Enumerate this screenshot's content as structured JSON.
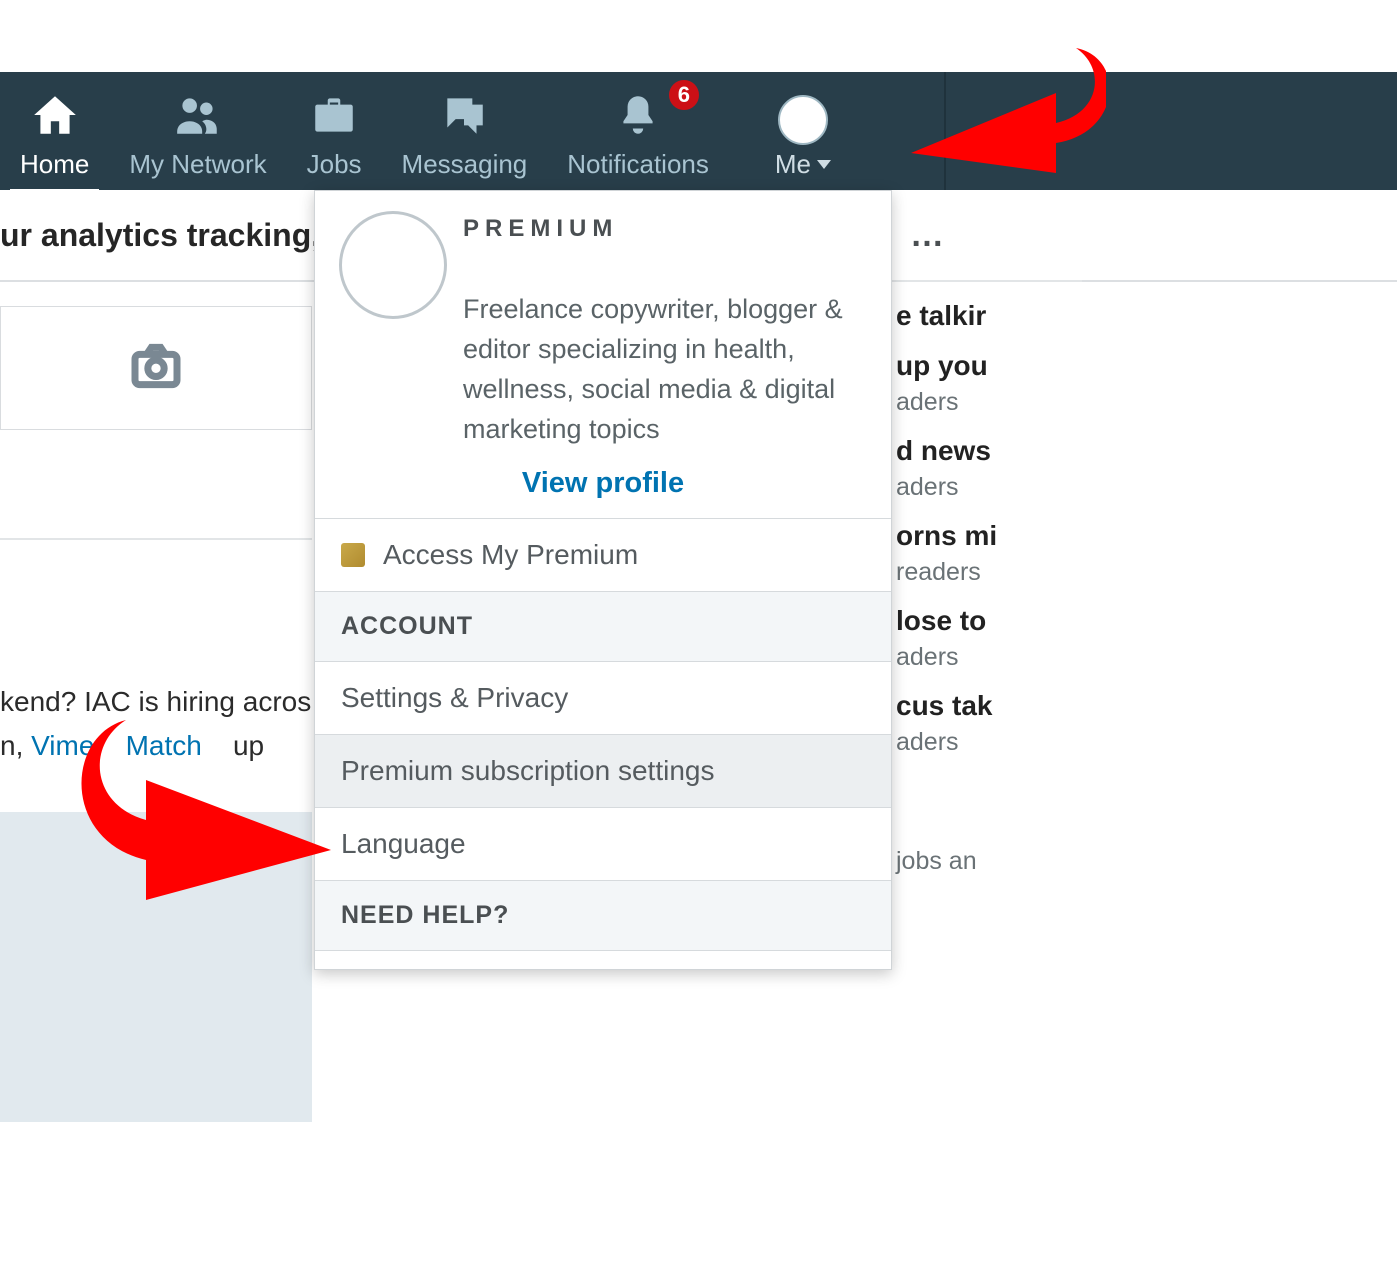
{
  "nav": {
    "items": [
      {
        "label": "Home",
        "active": true
      },
      {
        "label": "My Network"
      },
      {
        "label": "Jobs"
      },
      {
        "label": "Messaging"
      },
      {
        "label": "Notifications",
        "badge": "6"
      }
    ],
    "me_label": "Me"
  },
  "banner": {
    "text": "ur analytics tracking,"
  },
  "dropdown": {
    "premium_label": "PREMIUM",
    "headline": "Freelance copywriter, blogger & editor specializing in health, wellness, social media & digital marketing topics",
    "view_profile": "View profile",
    "access_premium": "Access My Premium",
    "account_header": "ACCOUNT",
    "settings_privacy": "Settings & Privacy",
    "premium_sub": "Premium subscription settings",
    "language": "Language",
    "need_help_header": "NEED HELP?"
  },
  "feed": {
    "line1": "kend? IAC is hiring acros",
    "line2_prefix": "n, ",
    "line2_link1": "Vime",
    "line2_link2": "Match",
    "line2_suffix": "up"
  },
  "right": {
    "ellipsis": "…",
    "items": [
      {
        "title": "e talkir"
      },
      {
        "title": "up you",
        "sub": "aders"
      },
      {
        "title": "d news",
        "sub": "aders"
      },
      {
        "title": "orns mi",
        "sub": " readers"
      },
      {
        "title": "lose to",
        "sub": "aders"
      },
      {
        "title": "cus tak",
        "sub": "aders"
      }
    ],
    "last": " jobs an"
  },
  "colors": {
    "accent": "#0073b1",
    "badge": "#cc1016"
  }
}
